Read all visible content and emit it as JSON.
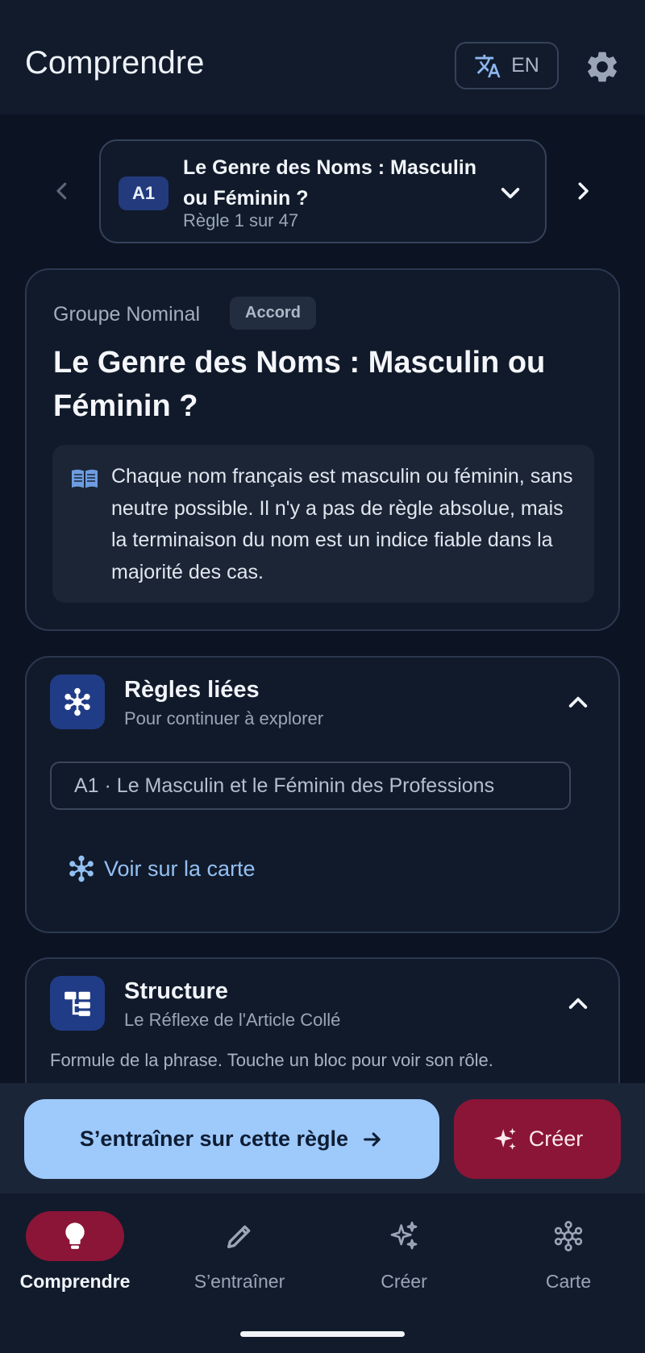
{
  "header": {
    "title": "Comprendre",
    "lang_label": "EN"
  },
  "rule_selector": {
    "level": "A1",
    "title": "Le Genre des Noms : Masculin ou Féminin ?",
    "position": "Règle 1 sur 47"
  },
  "main_card": {
    "category": "Groupe Nominal",
    "tag": "Accord",
    "title": "Le Genre des Noms : Masculin ou Féminin ?",
    "description": "Chaque nom français est masculin ou féminin, sans neutre possible. Il n'y a pas de règle absolue, mais la terminaison du nom est un indice fiable dans la majorité des cas."
  },
  "related": {
    "title": "Règles liées",
    "subtitle": "Pour continuer à explorer",
    "items": [
      {
        "label": "A1 · Le Masculin et le Féminin des Professions"
      }
    ],
    "map_link": "Voir sur la carte"
  },
  "structure": {
    "title": "Structure",
    "subtitle": "Le Réflexe de l'Article Collé",
    "description": "Formule de la phrase. Touche un bloc pour voir son rôle."
  },
  "actions": {
    "practice_label": "S’entraîner sur cette règle",
    "create_label": "Créer"
  },
  "nav": {
    "items": [
      {
        "label": "Comprendre",
        "icon": "lightbulb-icon",
        "active": true
      },
      {
        "label": "S’entraîner",
        "icon": "pencil-icon",
        "active": false
      },
      {
        "label": "Créer",
        "icon": "sparkles-icon",
        "active": false
      },
      {
        "label": "Carte",
        "icon": "network-icon",
        "active": false
      }
    ]
  },
  "colors": {
    "accent_blue": "#9ec9fb",
    "accent_red": "#8a1537",
    "badge_blue": "#233a7c",
    "background": "#0c1423"
  }
}
